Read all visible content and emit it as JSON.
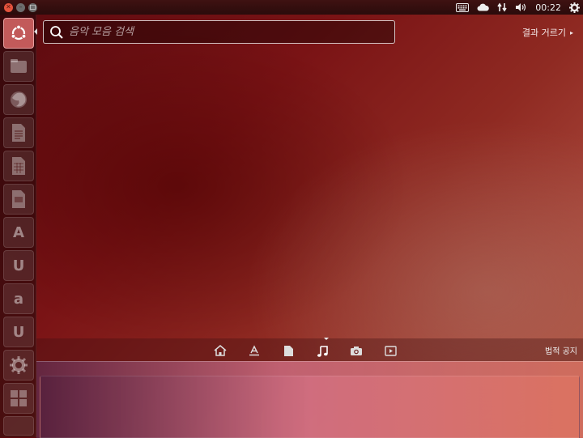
{
  "top_panel": {
    "clock": "00:22",
    "window_controls": [
      "close-icon",
      "minimize-icon",
      "maximize-icon"
    ],
    "indicators": [
      "keyboard-icon",
      "cloud-icon",
      "network-icon",
      "volume-icon",
      "gear-icon"
    ]
  },
  "launcher": {
    "items": [
      {
        "name": "ubuntu-logo-icon"
      },
      {
        "name": "files-icon"
      },
      {
        "name": "firefox-icon"
      },
      {
        "name": "writer-icon"
      },
      {
        "name": "calc-icon"
      },
      {
        "name": "impress-icon"
      },
      {
        "name": "software-center-icon",
        "glyph": "A"
      },
      {
        "name": "ubuntu-one-icon",
        "glyph": "U"
      },
      {
        "name": "amazon-icon",
        "glyph": "a"
      },
      {
        "name": "ubuntu-one-music-icon",
        "glyph": "U"
      },
      {
        "name": "system-settings-icon"
      },
      {
        "name": "workspace-switcher-icon"
      }
    ]
  },
  "search": {
    "placeholder": "음악 모음 검색"
  },
  "filter": {
    "label": "결과 거르기"
  },
  "lens_bar": {
    "lenses": [
      "home-icon",
      "applications-icon",
      "files-icon",
      "music-icon",
      "photos-icon",
      "video-icon"
    ],
    "active_lens": "music-icon",
    "legal_label": "법적 공지"
  }
}
